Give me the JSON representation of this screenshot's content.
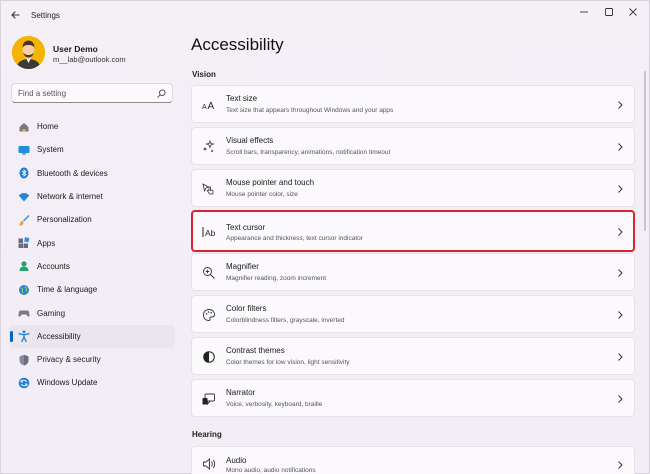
{
  "window": {
    "title": "Settings"
  },
  "user": {
    "name": "User Demo",
    "email": "m__lab@outlook.com"
  },
  "search": {
    "placeholder": "Find a setting"
  },
  "sidebar": {
    "items": [
      {
        "label": "Home",
        "icon": "home-icon"
      },
      {
        "label": "System",
        "icon": "system-icon"
      },
      {
        "label": "Bluetooth & devices",
        "icon": "bluetooth-icon"
      },
      {
        "label": "Network & internet",
        "icon": "network-icon"
      },
      {
        "label": "Personalization",
        "icon": "brush-icon"
      },
      {
        "label": "Apps",
        "icon": "apps-icon"
      },
      {
        "label": "Accounts",
        "icon": "accounts-icon"
      },
      {
        "label": "Time & language",
        "icon": "globe-icon"
      },
      {
        "label": "Gaming",
        "icon": "gaming-icon"
      },
      {
        "label": "Accessibility",
        "icon": "accessibility-icon",
        "active": true
      },
      {
        "label": "Privacy & security",
        "icon": "shield-icon"
      },
      {
        "label": "Windows Update",
        "icon": "update-icon"
      }
    ]
  },
  "main": {
    "title": "Accessibility",
    "sections": {
      "vision": "Vision",
      "hearing": "Hearing"
    },
    "cards": [
      {
        "title": "Text size",
        "desc": "Text size that appears throughout Windows and your apps",
        "icon": "text-size-icon"
      },
      {
        "title": "Visual effects",
        "desc": "Scroll bars, transparency, animations, notification timeout",
        "icon": "visual-effects-icon"
      },
      {
        "title": "Mouse pointer and touch",
        "desc": "Mouse pointer color, size",
        "icon": "mouse-pointer-icon"
      },
      {
        "title": "Text cursor",
        "desc": "Appearance and thickness, text cursor indicator",
        "icon": "text-cursor-icon",
        "highlighted": true
      },
      {
        "title": "Magnifier",
        "desc": "Magnifier reading, zoom increment",
        "icon": "magnifier-icon"
      },
      {
        "title": "Color filters",
        "desc": "Colorblindness filters, grayscale, inverted",
        "icon": "color-filters-icon"
      },
      {
        "title": "Contrast themes",
        "desc": "Color themes for low vision, light sensitivity",
        "icon": "contrast-icon"
      },
      {
        "title": "Narrator",
        "desc": "Voice, verbosity, keyboard, braille",
        "icon": "narrator-icon"
      },
      {
        "title": "Audio",
        "desc": "Mono audio, audio notifications",
        "icon": "audio-icon"
      }
    ]
  },
  "colors": {
    "accent": "#0067c0",
    "highlight_border": "#d6252e",
    "avatar_bg": "#f5b400"
  }
}
